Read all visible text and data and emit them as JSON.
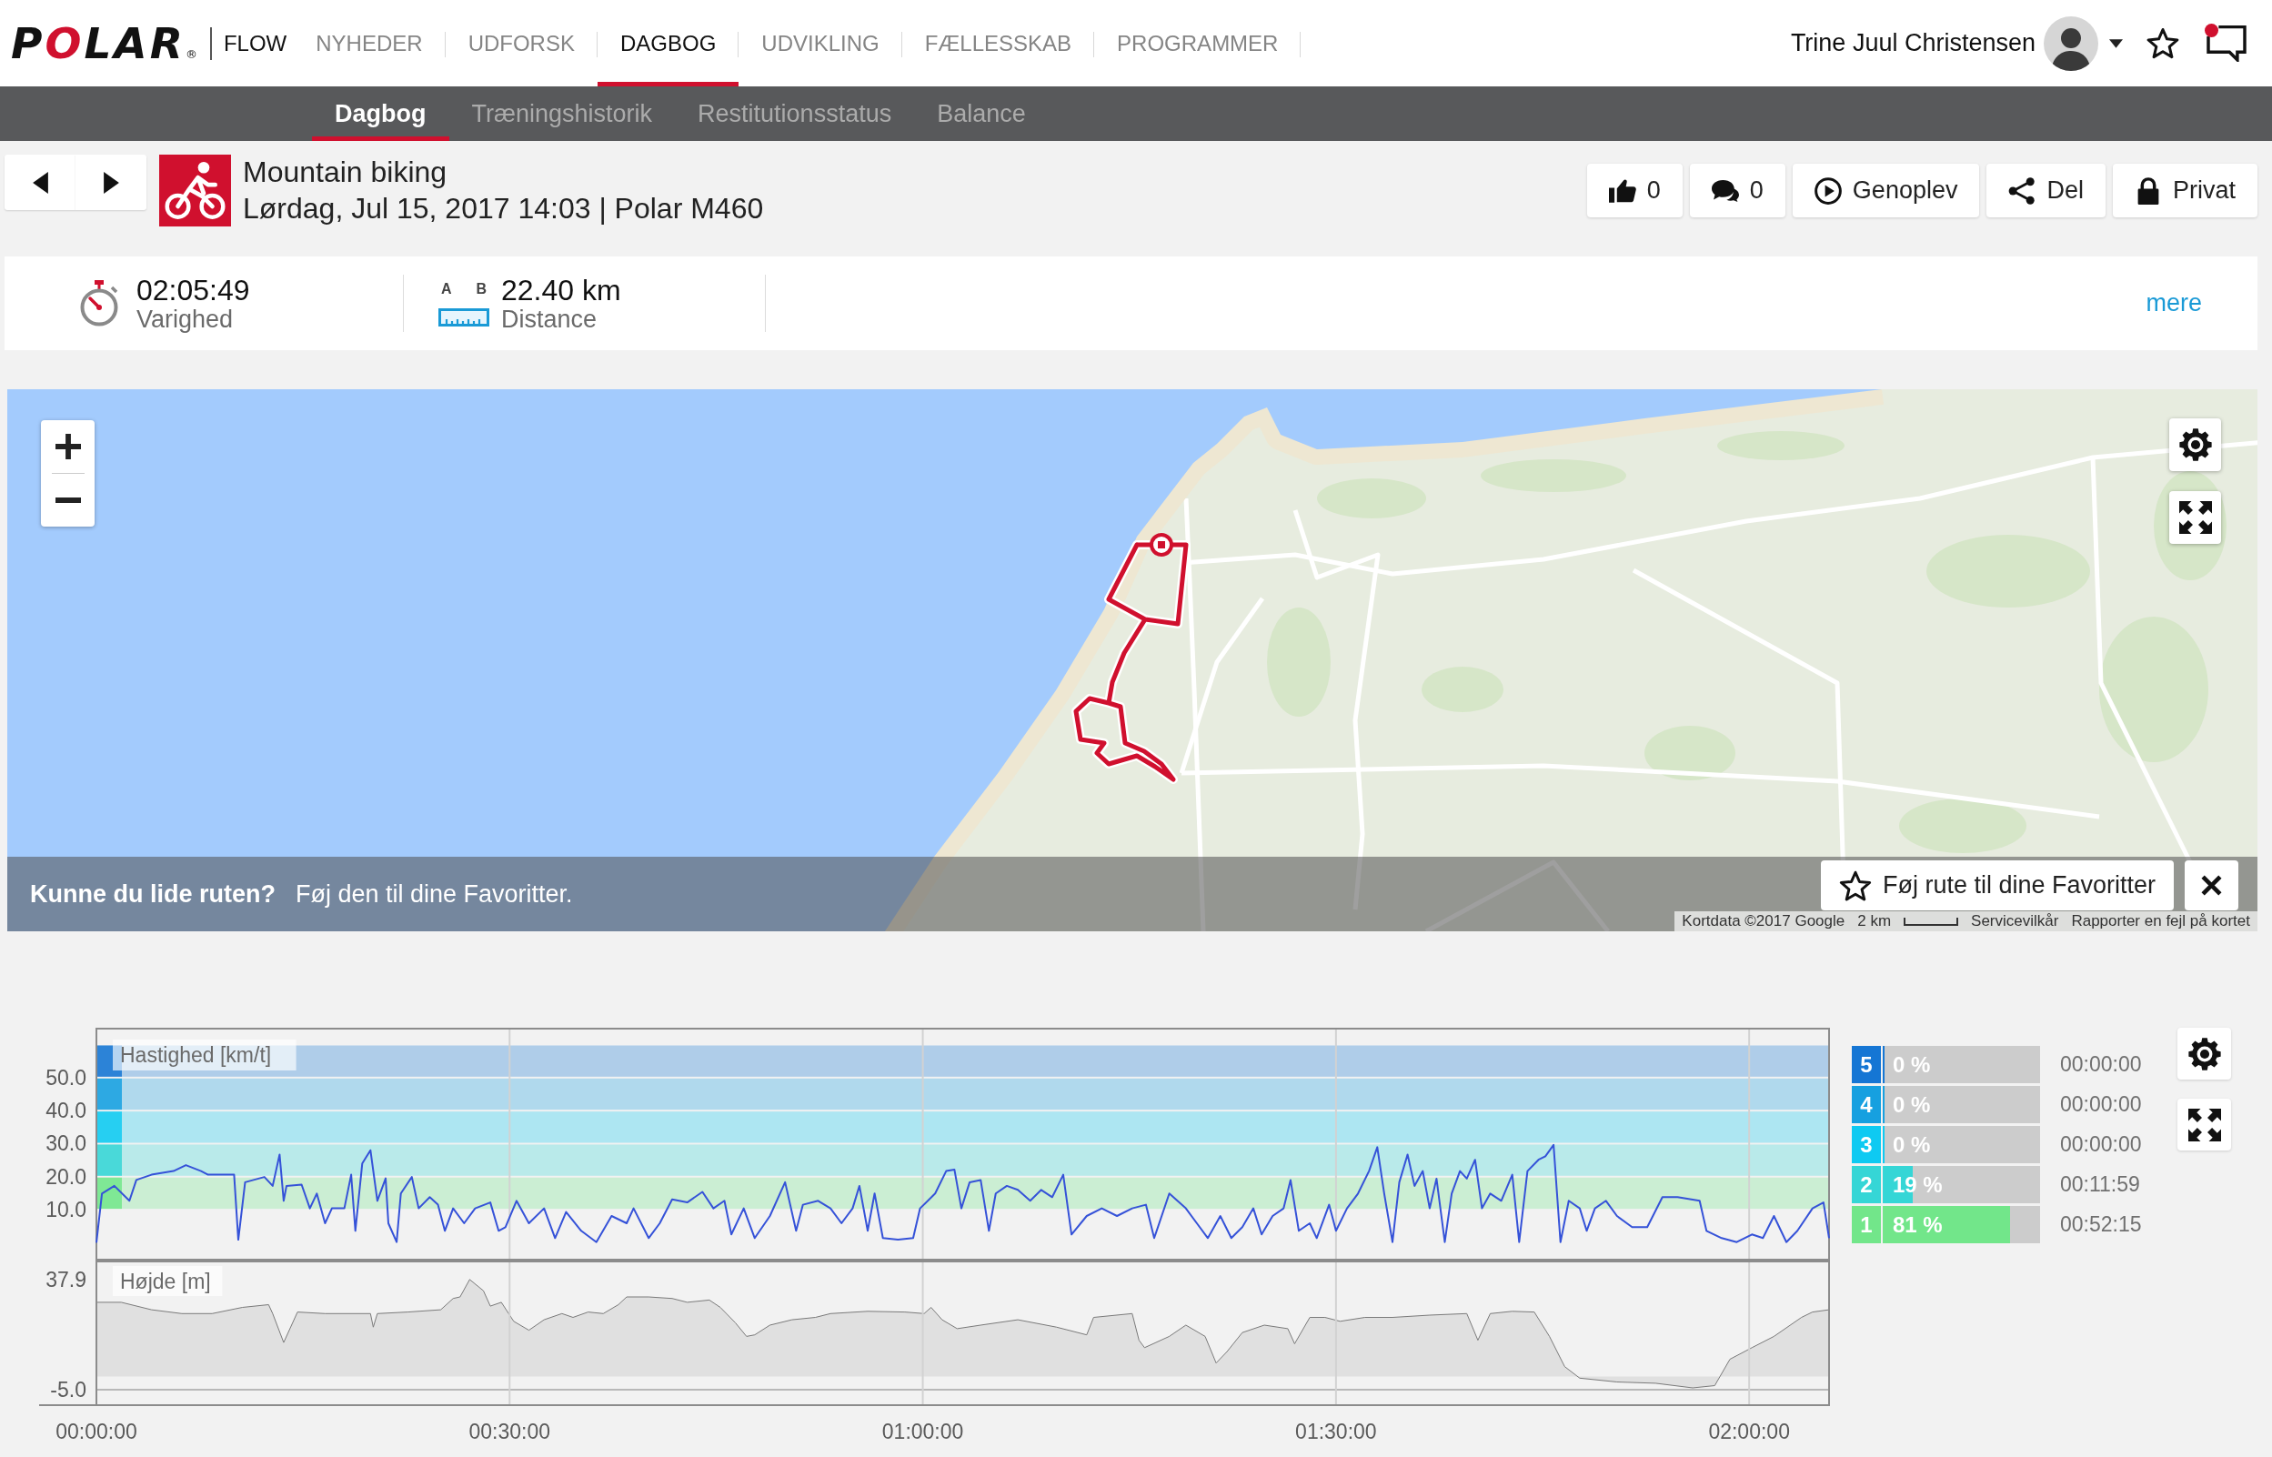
{
  "top_nav": {
    "logo": "POLAR",
    "logo_mark": "®",
    "product": "FLOW",
    "tabs": [
      {
        "label": "NYHEDER",
        "selected": false
      },
      {
        "label": "UDFORSK",
        "selected": false
      },
      {
        "label": "DAGBOG",
        "selected": true
      },
      {
        "label": "UDVIKLING",
        "selected": false
      },
      {
        "label": "FÆLLESSKAB",
        "selected": false
      },
      {
        "label": "PROGRAMMER",
        "selected": false
      }
    ],
    "user": {
      "name": "Trine Juul Christensen"
    },
    "notifications": {
      "unread": true
    }
  },
  "sub_nav": {
    "tabs": [
      {
        "label": "Dagbog",
        "selected": true
      },
      {
        "label": "Træningshistorik",
        "selected": false
      },
      {
        "label": "Restitutionsstatus",
        "selected": false
      },
      {
        "label": "Balance",
        "selected": false
      }
    ]
  },
  "activity": {
    "sport": "Mountain biking",
    "details": "Lørdag, Jul 15, 2017 14:03 | Polar M460",
    "actions": [
      {
        "kind": "like",
        "label": "0"
      },
      {
        "kind": "comment",
        "label": "0"
      },
      {
        "kind": "replay",
        "label": "Genoplev"
      },
      {
        "kind": "share",
        "label": "Del"
      },
      {
        "kind": "privacy",
        "label": "Privat"
      }
    ]
  },
  "summary": {
    "stats": [
      {
        "kind": "duration",
        "value": "02:05:49",
        "label": "Varighed"
      },
      {
        "kind": "distance",
        "endpoints": [
          "A",
          "B"
        ],
        "value": "22.40 km",
        "label": "Distance"
      }
    ],
    "more": "mere"
  },
  "map": {
    "banner": {
      "question": "Kunne du lide ruten?",
      "suggestion": "Føj den til dine Favoritter.",
      "button": "Føj rute til dine Favoritter"
    },
    "attribution": "Kortdata ©2017 Google",
    "scale": "2 km",
    "links": [
      "Servicevilkår",
      "Rapporter en fejl på kortet"
    ]
  },
  "analysis": {
    "speed_chart": {
      "chart_data": {
        "type": "line",
        "title": "Hastighed [km/t]",
        "x": [
          0,
          0.4,
          1.3,
          2.4,
          2.9,
          4.0,
          5.6,
          6.5,
          7.6,
          8.1,
          10.0,
          10.3,
          10.8,
          12.2,
          12.8,
          13.3,
          13.6,
          13.8,
          14.9,
          15.5,
          16.0,
          16.6,
          17.1,
          18.0,
          18.5,
          18.8,
          19.3,
          19.9,
          20.4,
          21.0,
          21.2,
          21.8,
          22.1,
          22.9,
          23.4,
          24.2,
          24.8,
          25.3,
          25.9,
          26.7,
          27.5,
          28.6,
          29.2,
          29.7,
          30.5,
          31.4,
          32.5,
          33.3,
          34.1,
          35.2,
          36.3,
          37.4,
          38.5,
          39.0,
          40.1,
          40.9,
          41.8,
          42.9,
          44.0,
          44.8,
          45.6,
          46.1,
          47.0,
          47.8,
          48.9,
          50.0,
          50.8,
          51.3,
          52.4,
          53.3,
          54.1,
          54.9,
          55.4,
          56.0,
          56.5,
          57.1,
          58.2,
          59.3,
          59.8,
          60.9,
          61.7,
          62.3,
          62.8,
          63.4,
          64.2,
          64.8,
          65.3,
          66.1,
          66.9,
          67.8,
          68.6,
          69.4,
          70.2,
          70.8,
          71.9,
          73.0,
          74.1,
          75.2,
          76.2,
          76.8,
          77.9,
          79.1,
          79.9,
          80.7,
          81.6,
          82.4,
          83.2,
          84.0,
          84.6,
          85.4,
          86.2,
          86.7,
          87.3,
          88.1,
          88.6,
          89.5,
          90.0,
          90.8,
          91.6,
          92.4,
          93.0,
          93.5,
          94.1,
          94.6,
          95.2,
          95.7,
          96.3,
          96.8,
          97.3,
          97.9,
          98.4,
          99.0,
          99.5,
          100.1,
          100.6,
          101.2,
          102.0,
          102.8,
          103.3,
          103.9,
          104.7,
          105.2,
          105.8,
          106.3,
          106.9,
          107.7,
          108.2,
          108.8,
          109.6,
          110.4,
          111.5,
          112.6,
          113.7,
          114.8,
          116.4,
          116.9,
          118.0,
          119.1,
          120.2,
          121.0,
          121.8,
          122.7,
          123.5,
          124.6,
          125.4,
          125.8
        ],
        "values": [
          0,
          14.9,
          17.2,
          12.7,
          19.0,
          20.6,
          21.7,
          23.5,
          21.7,
          20.6,
          20.6,
          0.9,
          18.3,
          19.9,
          17.2,
          26.7,
          12.7,
          17.2,
          17.6,
          10.4,
          14.9,
          5.9,
          10.4,
          10.4,
          20.6,
          3.6,
          24.0,
          28.0,
          12.7,
          19.5,
          5.9,
          0.2,
          14.9,
          19.9,
          10.4,
          13.8,
          11.5,
          3.6,
          10.4,
          5.9,
          10.4,
          12.2,
          3.6,
          4.7,
          12.7,
          5.9,
          10.4,
          1.4,
          9.3,
          3.6,
          0.2,
          8.1,
          5.9,
          10.4,
          1.4,
          5.9,
          13.1,
          12.2,
          15.4,
          10.4,
          12.7,
          2.5,
          10.4,
          1.4,
          8.1,
          18.3,
          3.6,
          11.5,
          12.7,
          10.4,
          5.9,
          10.4,
          17.2,
          3.6,
          14.9,
          1.4,
          0.9,
          1.4,
          10.4,
          14.9,
          21.7,
          22.1,
          10.4,
          18.3,
          19.0,
          3.6,
          14.9,
          17.2,
          16.0,
          12.7,
          16.0,
          13.8,
          20.6,
          2.5,
          8.1,
          10.4,
          8.1,
          10.4,
          11.5,
          1.4,
          14.9,
          10.4,
          5.9,
          1.4,
          8.1,
          1.4,
          4.7,
          10.4,
          2.5,
          8.1,
          10.4,
          19.0,
          3.6,
          5.9,
          1.4,
          11.5,
          3.6,
          10.4,
          14.9,
          21.7,
          28.9,
          14.9,
          0.2,
          18.3,
          26.7,
          17.2,
          21.7,
          10.4,
          19.4,
          0.2,
          14.9,
          21.7,
          19.4,
          25.1,
          10.4,
          14.9,
          12.7,
          20.6,
          0.2,
          21.7,
          25.1,
          26.2,
          29.6,
          0.2,
          12.7,
          10.4,
          3.6,
          10.4,
          12.7,
          8.1,
          4.7,
          4.7,
          13.8,
          13.8,
          12.7,
          3.6,
          1.4,
          0.2,
          2.5,
          1.4,
          8.1,
          0.2,
          3.6,
          10.4,
          12.2,
          1.4
        ],
        "xlim": [
          0,
          125.8
        ],
        "ylim": [
          -5.4,
          65.1
        ],
        "yticks": [
          {
            "value": 10,
            "label": "10.0"
          },
          {
            "value": 20,
            "label": "20.0"
          },
          {
            "value": 30,
            "label": "30.0"
          },
          {
            "value": 40,
            "label": "40.0"
          },
          {
            "value": 50,
            "label": "50.0"
          }
        ],
        "grid": true
      }
    },
    "altitude_chart": {
      "chart_data": {
        "type": "area",
        "title": "Højde [m]",
        "x": [
          0,
          1.8,
          4.0,
          6.2,
          8.4,
          10.6,
          12.5,
          12.8,
          13.6,
          14.6,
          16.6,
          19.9,
          20.1,
          20.4,
          22.6,
          25.0,
          25.9,
          26.4,
          27.1,
          28.1,
          28.6,
          29.4,
          30.3,
          31.4,
          32.5,
          33.8,
          34.6,
          35.7,
          36.8,
          37.9,
          38.5,
          40.1,
          41.8,
          42.9,
          44.5,
          45.3,
          46.4,
          47.2,
          47.8,
          48.9,
          50.5,
          52.2,
          53.3,
          56.0,
          58.7,
          60.1,
          60.6,
          61.4,
          62.5,
          64.2,
          66.9,
          69.7,
          71.9,
          72.4,
          75.2,
          75.7,
          76.1,
          77.9,
          79.1,
          80.5,
          81.3,
          82.1,
          83.2,
          84.8,
          86.5,
          87.0,
          88.1,
          89.2,
          90.3,
          92.1,
          94.1,
          96.8,
          99.5,
          100.3,
          101.2,
          102.8,
          104.4,
          105.5,
          106.6,
          107.7,
          110.4,
          113.2,
          115.9,
          117.5,
          118.6,
          120.2,
          121.8,
          123.8,
          124.6,
          125.8
        ],
        "values": [
          29.0,
          29.0,
          26.1,
          24.6,
          24.6,
          27.0,
          28.1,
          24.6,
          13.3,
          25.2,
          24.6,
          24.6,
          19.3,
          24.6,
          25.2,
          26.1,
          30.5,
          31.1,
          37.9,
          33.5,
          27.5,
          29.0,
          21.6,
          18.1,
          22.2,
          24.6,
          23.1,
          25.2,
          24.6,
          28.1,
          31.1,
          31.1,
          30.5,
          29.0,
          29.9,
          27.0,
          21.0,
          15.7,
          16.3,
          20.1,
          22.2,
          23.1,
          24.6,
          25.5,
          25.2,
          24.6,
          27.0,
          22.2,
          18.7,
          20.1,
          22.2,
          19.3,
          16.3,
          23.1,
          24.6,
          14.2,
          11.3,
          15.7,
          20.1,
          15.7,
          5.3,
          9.8,
          17.2,
          20.1,
          18.7,
          12.8,
          23.1,
          23.1,
          21.6,
          23.1,
          23.1,
          24.0,
          24.6,
          14.2,
          24.6,
          25.5,
          25.2,
          15.7,
          3.9,
          -0.6,
          -2.1,
          -2.6,
          -4.4,
          -3.5,
          6.8,
          11.3,
          15.7,
          23.1,
          25.2,
          26.1
        ],
        "xlim": [
          0,
          125.8
        ],
        "ylim": [
          -11.5,
          45.3
        ],
        "yticks": [
          {
            "value": -5,
            "label": "-5.0"
          },
          {
            "value": 37.9,
            "label": "37.9"
          }
        ],
        "xticks": [
          {
            "value": 0,
            "label": "00:00:00"
          },
          {
            "value": 30,
            "label": "00:30:00"
          },
          {
            "value": 60,
            "label": "01:00:00"
          },
          {
            "value": 90,
            "label": "01:30:00"
          },
          {
            "value": 120,
            "label": "02:00:00"
          }
        ],
        "grid": true
      }
    },
    "zones": [
      {
        "number": "5",
        "percent": "0 %",
        "level": 0,
        "time": "00:00:00",
        "color": "#1576d4"
      },
      {
        "number": "4",
        "percent": "0 %",
        "level": 0,
        "time": "00:00:00",
        "color": "#16a0e0"
      },
      {
        "number": "3",
        "percent": "0 %",
        "level": 0,
        "time": "00:00:00",
        "color": "#0ecaf2"
      },
      {
        "number": "2",
        "percent": "19 %",
        "level": 0.19,
        "time": "00:11:59",
        "color": "#35d6d6"
      },
      {
        "number": "1",
        "percent": "81 %",
        "level": 0.81,
        "time": "00:52:15",
        "color": "#72e68a"
      }
    ]
  }
}
